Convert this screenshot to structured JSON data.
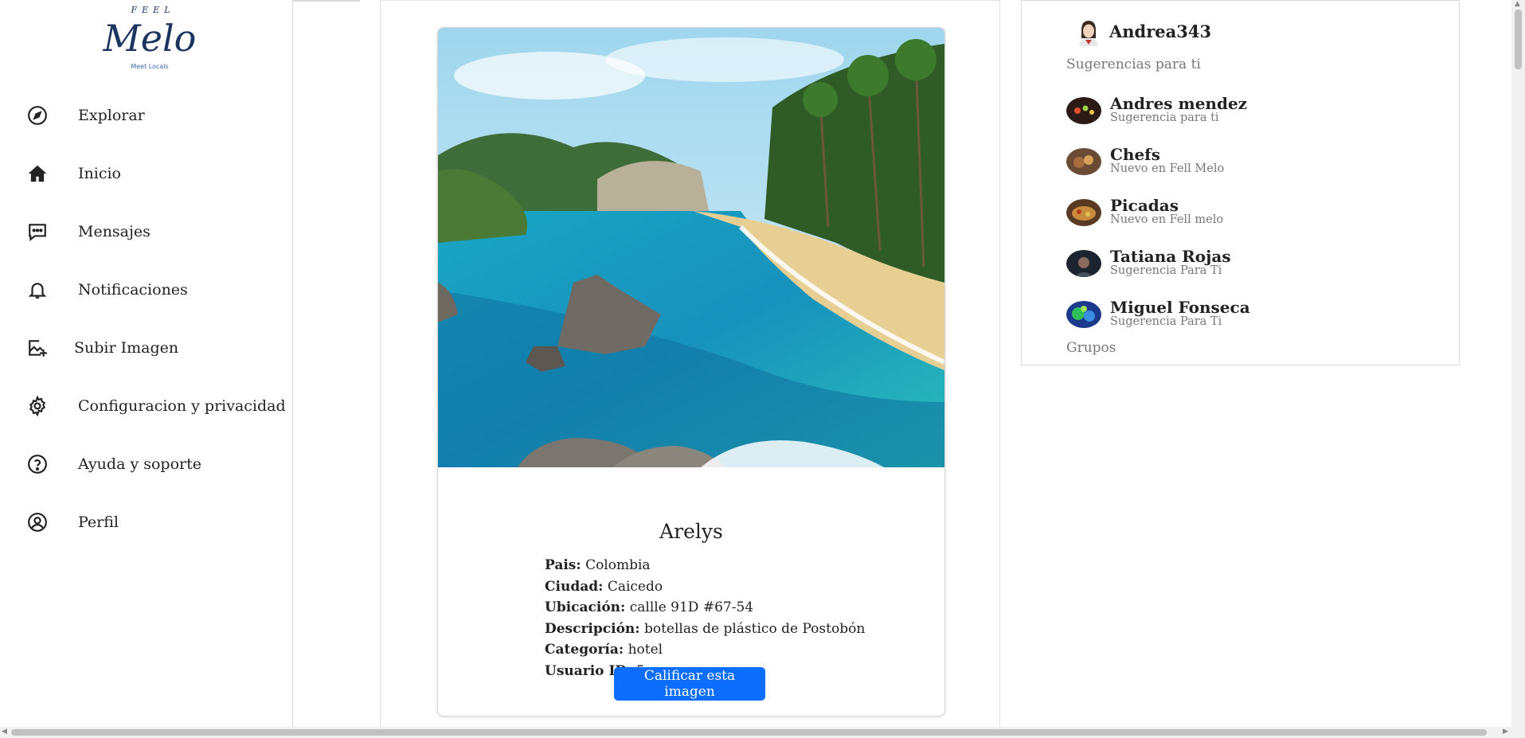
{
  "brand": {
    "top": "FEEL",
    "name": "Melo",
    "tagline": "Meet Locals"
  },
  "nav": [
    {
      "label": "Explorar",
      "icon": "compass-icon"
    },
    {
      "label": "Inicio",
      "icon": "home-icon"
    },
    {
      "label": "Mensajes",
      "icon": "message-icon"
    },
    {
      "label": "Notificaciones",
      "icon": "bell-icon"
    },
    {
      "label": "Subir Imagen",
      "icon": "image-add-icon"
    },
    {
      "label": "Configuracion y privacidad",
      "icon": "gear-icon"
    },
    {
      "label": "Ayuda y soporte",
      "icon": "help-icon"
    },
    {
      "label": "Perfil",
      "icon": "user-circle-icon"
    }
  ],
  "post": {
    "title": "Arelys",
    "fields": [
      {
        "label": "Pais:",
        "value": "Colombia"
      },
      {
        "label": "Ciudad:",
        "value": "Caicedo"
      },
      {
        "label": "Ubicación:",
        "value": "callle 91D #67-54"
      },
      {
        "label": "Descripción:",
        "value": "botellas de plástico de Postobón"
      },
      {
        "label": "Categoría:",
        "value": "hotel"
      },
      {
        "label": "Usuario ID:",
        "value": "5"
      }
    ],
    "rate_button": "Calificar esta imagen"
  },
  "sidebar_right": {
    "current_user": "Andrea343",
    "suggestions_heading": "Sugerencias para ti",
    "suggestions": [
      {
        "name": "Andres mendez",
        "subtitle": "Sugerencia para ti"
      },
      {
        "name": "Chefs",
        "subtitle": "Nuevo en Fell Melo"
      },
      {
        "name": "Picadas",
        "subtitle": "Nuevo en Fell melo"
      },
      {
        "name": "Tatiana Rojas",
        "subtitle": "Sugerencia Para Ti"
      },
      {
        "name": "Miguel Fonseca",
        "subtitle": "Sugerencia Para Ti"
      }
    ],
    "groups_heading": "Grupos"
  },
  "colors": {
    "accent": "#0d6efd",
    "brand": "#1f2f4f"
  }
}
